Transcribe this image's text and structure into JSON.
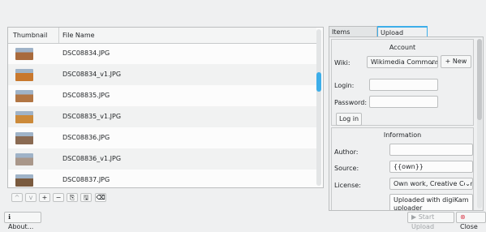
{
  "list": {
    "headers": {
      "thumbnail": "Thumbnail",
      "filename": "File Name"
    },
    "rows": [
      {
        "name": "DSC08834.JPG",
        "thumb_color": "#a86a3c"
      },
      {
        "name": "DSC08834_v1.JPG",
        "thumb_color": "#c8782e"
      },
      {
        "name": "DSC08835.JPG",
        "thumb_color": "#b27644"
      },
      {
        "name": "DSC08835_v1.JPG",
        "thumb_color": "#cc8a3a"
      },
      {
        "name": "DSC08836.JPG",
        "thumb_color": "#8a6a52"
      },
      {
        "name": "DSC08836_v1.JPG",
        "thumb_color": "#a9978a"
      },
      {
        "name": "DSC08837.JPG",
        "thumb_color": "#7a5a3e"
      }
    ]
  },
  "toolbar": {
    "up": "^",
    "down": "v",
    "add": "+",
    "remove": "−",
    "load": "⎘",
    "save": "🖫",
    "clear": "⌫"
  },
  "tabs": {
    "items_properties": "Items Properties",
    "upload_settings": "Upload Settings"
  },
  "account": {
    "title": "Account",
    "wiki_label": "Wiki:",
    "wiki_value": "Wikimedia Commons",
    "new_button": "+ New",
    "login_label": "Login:",
    "login_value": "",
    "password_label": "Password:",
    "password_value": "",
    "login_button": "Log in"
  },
  "information": {
    "title": "Information",
    "author_label": "Author:",
    "author_value": "",
    "source_label": "Source:",
    "source_value": "{{own}}",
    "license_label": "License:",
    "license_value": "Own work, Creative Commo",
    "description_value": "Uploaded with digiKam uploader"
  },
  "bottom": {
    "about": "About...",
    "start_upload": "Start Upload",
    "close": "Close"
  },
  "colors": {
    "accent": "#3daee9",
    "close_icon": "#da4453"
  }
}
